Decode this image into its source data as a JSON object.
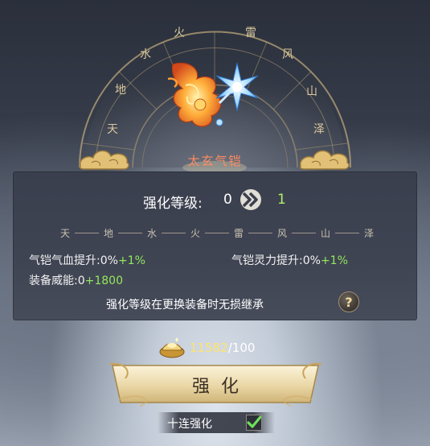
{
  "dial": {
    "characters": [
      "天",
      "地",
      "水",
      "火",
      "雷",
      "风",
      "山",
      "泽"
    ]
  },
  "item": {
    "name": "太玄气铠",
    "art_icon": "flame-phoenix-and-ice-star-relic-icon"
  },
  "enhance": {
    "level_label": "强化等级:",
    "current_level": "0",
    "next_level": "1",
    "arrow_icon": "double-chevron-right-icon"
  },
  "tiers": [
    "天",
    "地",
    "水",
    "火",
    "雷",
    "风",
    "山",
    "泽"
  ],
  "stats": {
    "hp": {
      "label": "气铠气血提升:",
      "current": "0%",
      "plus": "+1%"
    },
    "spirit": {
      "label": "气铠灵力提升:",
      "current": "0%",
      "plus": "+1%"
    },
    "power": {
      "label": "装备威能:",
      "current": "0",
      "plus": "+1800"
    }
  },
  "note": "强化等级在更换装备时无损继承",
  "help_label": "?",
  "cost": {
    "have": "11582",
    "separator": "/",
    "need": "100",
    "icon": "gold-ingot-icon"
  },
  "main_button_label": "强化",
  "ten_times": {
    "label": "十连强化",
    "checked": true
  },
  "colors": {
    "item_name": "#ff8c60",
    "next_level": "#b2f06a",
    "plus": "#92e85a",
    "cost_have": "#ffe36c"
  }
}
